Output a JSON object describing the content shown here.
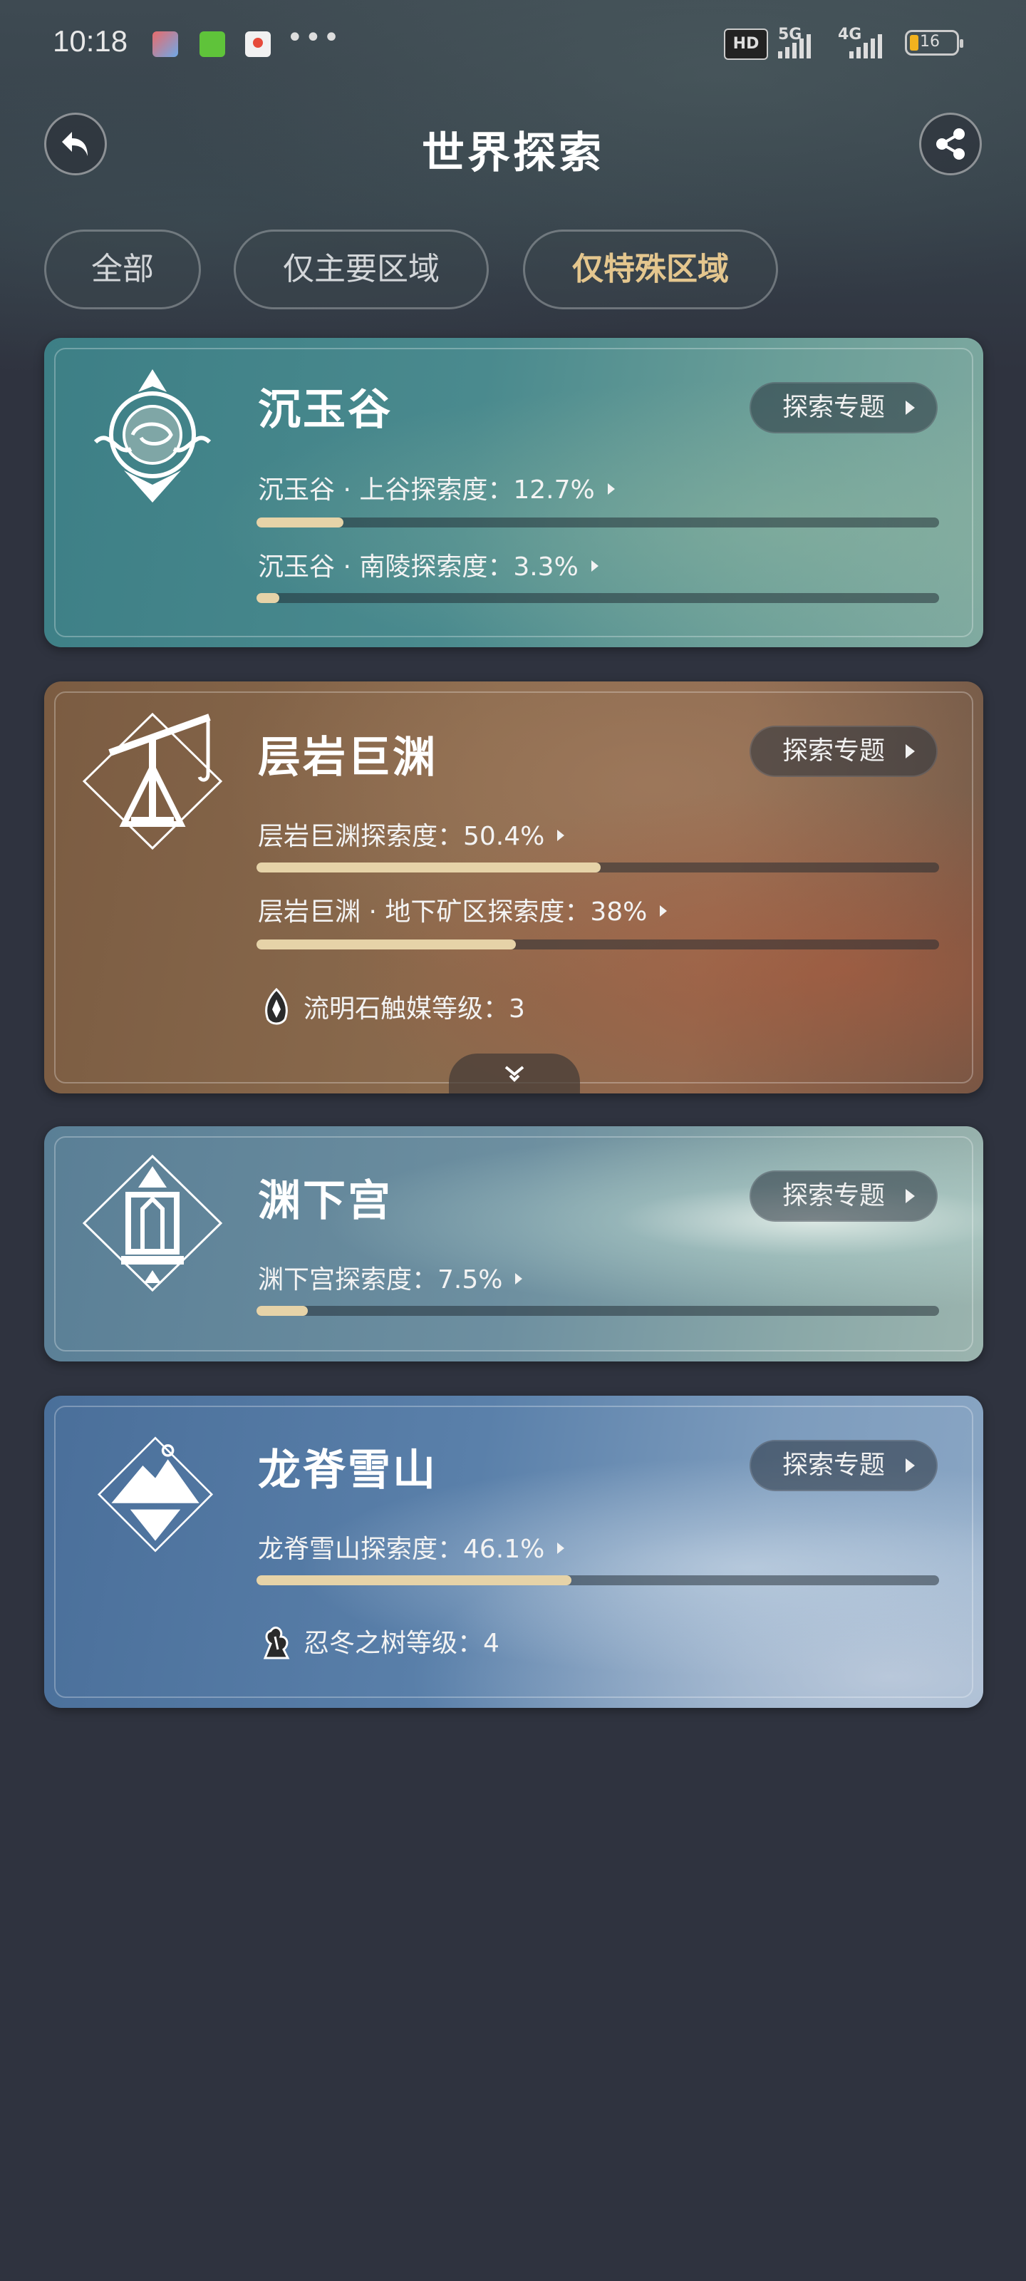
{
  "status_bar": {
    "time": "10:18",
    "network_hd": "HD",
    "network_1": "5G",
    "network_2": "4G",
    "battery": "16",
    "more": "•••"
  },
  "header": {
    "title": "世界探索",
    "back_icon": "back-arrow-icon",
    "share_icon": "share-icon"
  },
  "tabs": [
    {
      "label": "全部",
      "active": false
    },
    {
      "label": "仅主要区域",
      "active": false
    },
    {
      "label": "仅特殊区域",
      "active": true
    }
  ],
  "colors": {
    "active_tab": "#e4c68e",
    "progress_fill": "#e6d3a8",
    "background": "#2f333f"
  },
  "regions": [
    {
      "name": "沉玉谷",
      "topic_button": "探索专题",
      "emblem_icon": "chenyu-vale-emblem-icon",
      "progress": [
        {
          "label": "沉玉谷 · 上谷探索度：12.7%",
          "value": 0.127
        },
        {
          "label": "沉玉谷 · 南陵探索度：3.3%",
          "value": 0.033
        }
      ]
    },
    {
      "name": "层岩巨渊",
      "topic_button": "探索专题",
      "emblem_icon": "chasm-emblem-icon",
      "progress": [
        {
          "label": "层岩巨渊探索度：50.4%",
          "value": 0.504
        },
        {
          "label": "层岩巨渊 · 地下矿区探索度：38%",
          "value": 0.38
        }
      ],
      "extra": {
        "label": "流明石触媒等级：3",
        "icon": "lumenstone-icon"
      }
    },
    {
      "name": "渊下宫",
      "topic_button": "探索专题",
      "emblem_icon": "enkanomiya-emblem-icon",
      "progress": [
        {
          "label": "渊下宫探索度：7.5%",
          "value": 0.075
        }
      ]
    },
    {
      "name": "龙脊雪山",
      "topic_button": "探索专题",
      "emblem_icon": "dragonspine-emblem-icon",
      "progress": [
        {
          "label": "龙脊雪山探索度：46.1%",
          "value": 0.461
        }
      ],
      "extra": {
        "label": "忍冬之树等级：4",
        "icon": "frostbearing-tree-icon"
      }
    }
  ]
}
